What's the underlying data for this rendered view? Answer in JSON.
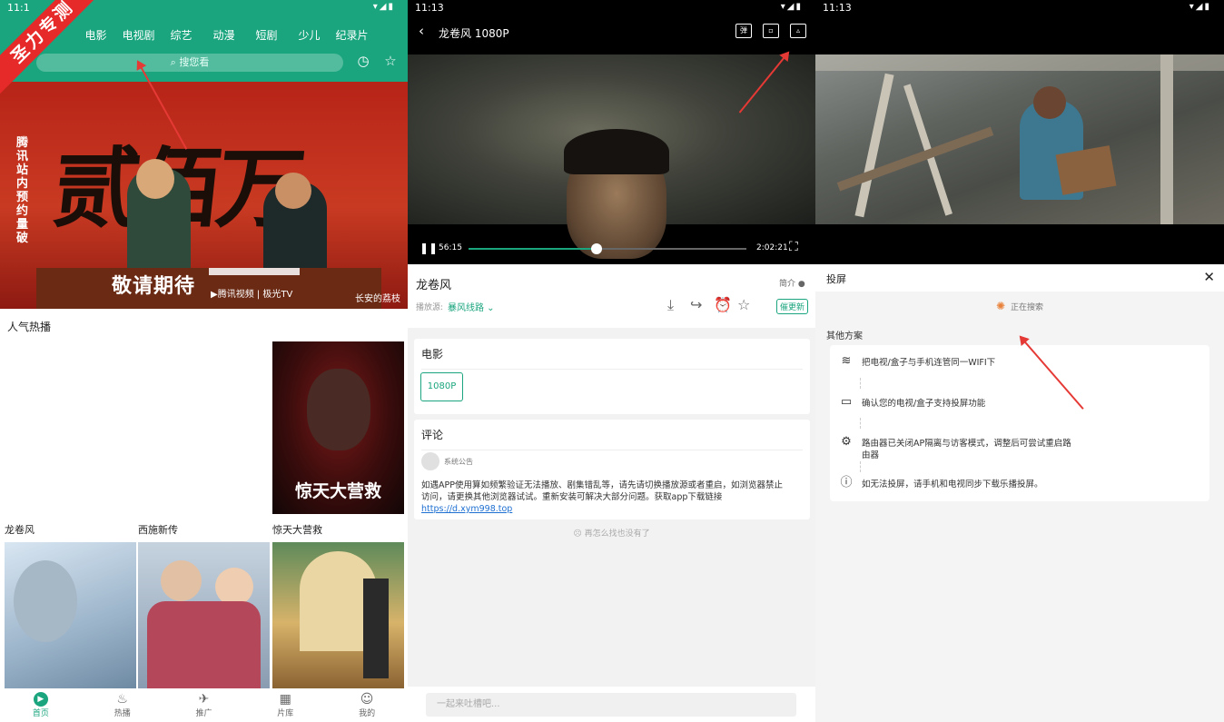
{
  "left": {
    "status_time": "11:1",
    "ribbon": "圣力专测",
    "categories": [
      "电影",
      "电视剧",
      "综艺",
      "动漫",
      "短剧",
      "少儿",
      "纪录片"
    ],
    "search_placeholder": "搜您看",
    "banner": {
      "big_text": "贰佰万",
      "side_text": "腾讯站内预约量破",
      "title": "敬请期待",
      "logos": "▶腾讯视频 | 极光TV",
      "name": "长安的荔枝"
    },
    "section_title": "人气热播",
    "posters": [
      {
        "caption": "龙卷风"
      },
      {
        "caption": "西施新传"
      },
      {
        "caption": "惊天大营救",
        "overlay": "惊天大营救"
      }
    ],
    "tabs": [
      {
        "label": "首页",
        "icon": "▶"
      },
      {
        "label": "热播",
        "icon": "♨"
      },
      {
        "label": "推广",
        "icon": "✈"
      },
      {
        "label": "片库",
        "icon": "▦"
      },
      {
        "label": "我的",
        "icon": "☺"
      }
    ]
  },
  "middle": {
    "status_time": "11:13",
    "video_title": "龙卷风 1080P",
    "player": {
      "current": "56:15",
      "total": "2:02:21",
      "progress": 0.46
    },
    "movie_title": "龙卷风",
    "intro_label": "简介",
    "source_label": "播放源:",
    "source_value": "暴风线路",
    "urge_label": "催更新",
    "quality_section": "电影",
    "quality_option": "1080P",
    "comments_section": "评论",
    "announcer": "系统公告",
    "notice_text": "如遇APP使用算如频繁验证无法播放、剧集错乱等，请先请切换播放源或者重启，如浏览器禁止访问，请更换其他浏览器试试。重新安装可解决大部分问题。获取app下载链接",
    "notice_link": "https://d.xym998.top",
    "no_more": "再怎么找也没有了",
    "comment_placeholder": "一起来吐槽吧..."
  },
  "right": {
    "status_time": "11:13",
    "cast_title": "投屏",
    "searching": "正在搜索",
    "other_solutions": "其他方案",
    "steps": [
      {
        "icon": "wifi-icon",
        "glyph": "≋",
        "text": "把电视/盒子与手机连管同一WIFI下"
      },
      {
        "icon": "tv-icon",
        "glyph": "▭",
        "text": "确认您的电视/盒子支持投屏功能"
      },
      {
        "icon": "gear-icon",
        "glyph": "⚙",
        "text": "路由器已关闭AP隔离与访客模式，调整后可尝试重启路由器"
      },
      {
        "icon": "info-icon",
        "glyph": "ⓘ",
        "text": "如无法投屏，请手机和电视同步下载乐播投屏。"
      }
    ]
  },
  "colors": {
    "brand_green": "#1aa57e",
    "arrow_red": "#e53935",
    "ribbon_red": "#e62a2a"
  }
}
